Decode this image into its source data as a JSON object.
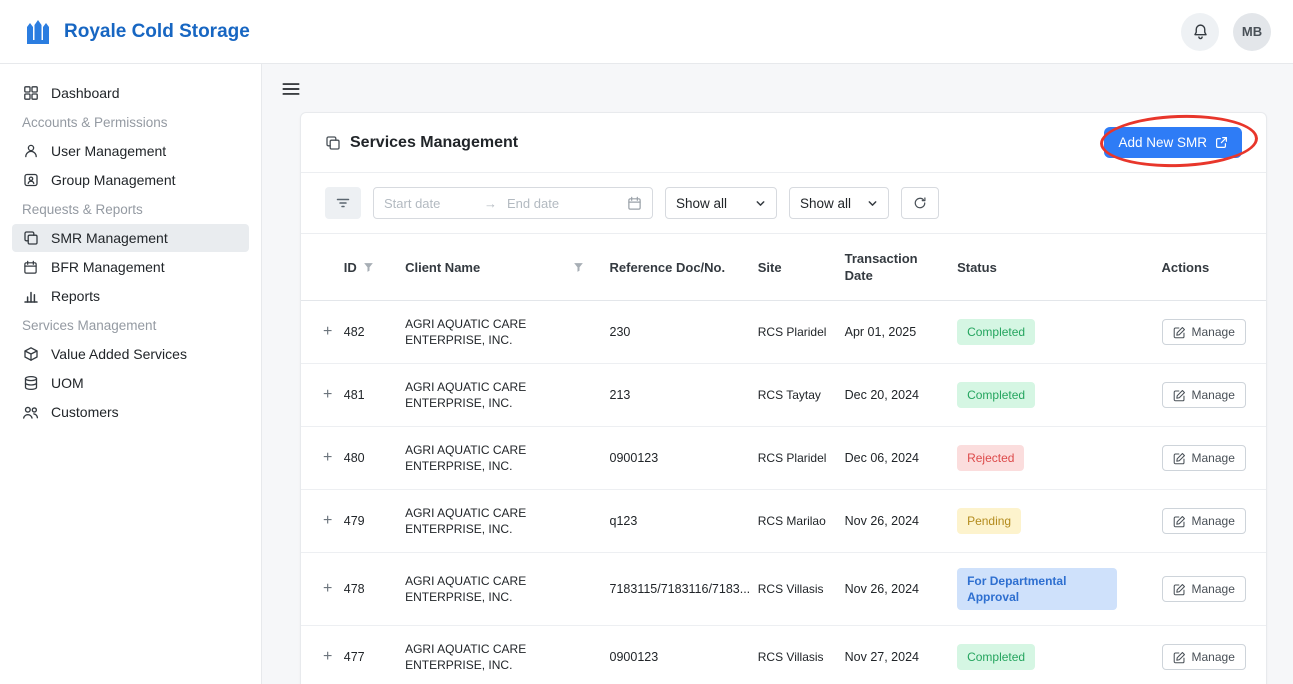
{
  "colors": {
    "brand_blue": "#1766c2",
    "primary_button": "#2e7cf6",
    "annotation_red": "#e8362b",
    "status_completed_bg": "#d5f6e3",
    "status_completed_text": "#25a55f",
    "status_rejected_bg": "#fbdddd",
    "status_rejected_text": "#dd4b4b",
    "status_pending_bg": "#fdf3cd",
    "status_pending_text": "#b38b1d",
    "status_approval_bg": "#cfe1fb",
    "status_approval_text": "#2e6fd0"
  },
  "header": {
    "brand": "Royale Cold Storage",
    "avatar_initials": "MB",
    "icons": [
      "castle-logo-icon",
      "bell-icon"
    ]
  },
  "sidebar": {
    "items": [
      {
        "type": "link",
        "label": "Dashboard",
        "icon": "grid-icon"
      },
      {
        "type": "section",
        "label": "Accounts & Permissions"
      },
      {
        "type": "link",
        "label": "User Management",
        "icon": "user-icon"
      },
      {
        "type": "link",
        "label": "Group Management",
        "icon": "group-box-icon"
      },
      {
        "type": "section",
        "label": "Requests & Reports"
      },
      {
        "type": "link",
        "label": "SMR Management",
        "icon": "copy-icon",
        "active": true
      },
      {
        "type": "link",
        "label": "BFR Management",
        "icon": "calendar-icon"
      },
      {
        "type": "link",
        "label": "Reports",
        "icon": "bar-chart-icon"
      },
      {
        "type": "section",
        "label": "Services Management"
      },
      {
        "type": "link",
        "label": "Value Added Services",
        "icon": "package-icon"
      },
      {
        "type": "link",
        "label": "UOM",
        "icon": "database-icon"
      },
      {
        "type": "link",
        "label": "Customers",
        "icon": "people-icon"
      }
    ]
  },
  "main": {
    "card_title": "Services Management",
    "add_button_label": "Add New SMR",
    "filters": {
      "start_date_placeholder": "Start date",
      "range_arrow": "→",
      "end_date_placeholder": "End date",
      "select_1_value": "Show all",
      "select_2_value": "Show all"
    },
    "table": {
      "headers": [
        "ID",
        "Client Name",
        "Reference Doc/No.",
        "Site",
        "Transaction Date",
        "Status",
        "Actions"
      ],
      "expand_symbol": "+",
      "manage_label": "Manage",
      "rows": [
        {
          "id": "482",
          "client": "AGRI AQUATIC CARE ENTERPRISE, INC.",
          "ref": "230",
          "site": "RCS Plaridel",
          "date": "Apr 01, 2025",
          "status": "Completed",
          "status_type": "completed"
        },
        {
          "id": "481",
          "client": "AGRI AQUATIC CARE ENTERPRISE, INC.",
          "ref": "213",
          "site": "RCS Taytay",
          "date": "Dec 20, 2024",
          "status": "Completed",
          "status_type": "completed"
        },
        {
          "id": "480",
          "client": "AGRI AQUATIC CARE ENTERPRISE, INC.",
          "ref": "0900123",
          "site": "RCS Plaridel",
          "date": "Dec 06, 2024",
          "status": "Rejected",
          "status_type": "rejected"
        },
        {
          "id": "479",
          "client": "AGRI AQUATIC CARE ENTERPRISE, INC.",
          "ref": "q123",
          "site": "RCS Marilao",
          "date": "Nov 26, 2024",
          "status": "Pending",
          "status_type": "pending"
        },
        {
          "id": "478",
          "client": "AGRI AQUATIC CARE ENTERPRISE, INC.",
          "ref": "7183115/7183116/7183...",
          "site": "RCS Villasis",
          "date": "Nov 26, 2024",
          "status": "For Departmental Approval",
          "status_type": "approval"
        },
        {
          "id": "477",
          "client": "AGRI AQUATIC CARE ENTERPRISE, INC.",
          "ref": "0900123",
          "site": "RCS Villasis",
          "date": "Nov 27, 2024",
          "status": "Completed",
          "status_type": "completed"
        }
      ]
    }
  }
}
